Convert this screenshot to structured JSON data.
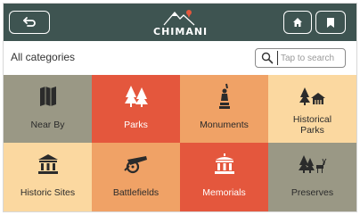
{
  "header": {
    "logo_text": "CHIMANI",
    "back_icon": "back-arrow-icon",
    "home_icon": "home-icon",
    "bookmark_icon": "bookmark-icon",
    "bar_color": "#3e5451"
  },
  "search": {
    "section_label": "All categories",
    "placeholder": "Tap to search",
    "value": ""
  },
  "categories": [
    {
      "label": "Near By",
      "icon": "map-icon",
      "color": "#9a9885"
    },
    {
      "label": "Parks",
      "icon": "trees-icon",
      "color": "#e4573d"
    },
    {
      "label": "Monuments",
      "icon": "statue-of-liberty-icon",
      "color": "#f0a266"
    },
    {
      "label": "Historical\nParks",
      "icon": "historic-park-icon",
      "color": "#fbd8a0"
    },
    {
      "label": "Historic Sites",
      "icon": "historic-building-icon",
      "color": "#fbd8a0"
    },
    {
      "label": "Battlefields",
      "icon": "cannon-icon",
      "color": "#f0a266"
    },
    {
      "label": "Memorials",
      "icon": "memorial-icon",
      "color": "#e4573d"
    },
    {
      "label": "Preserves",
      "icon": "preserve-trees-deer-icon",
      "color": "#9a9885"
    }
  ]
}
